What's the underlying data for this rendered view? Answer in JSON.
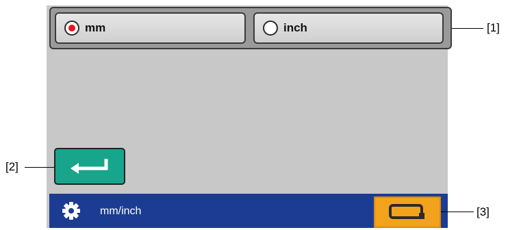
{
  "units": {
    "options": [
      {
        "label": "mm",
        "selected": true
      },
      {
        "label": "inch",
        "selected": false
      }
    ]
  },
  "status": {
    "title": "mm/inch",
    "icon": "gear-icon",
    "action_icon": "tape-cartridge-icon"
  },
  "enter_icon": "enter-arrow-icon",
  "callouts": [
    "[1]",
    "[2]",
    "[3]"
  ],
  "colors": {
    "status_bar": "#1b3c92",
    "enter_button": "#17a58c",
    "action_button": "#f3a21c",
    "selected_radio": "#e8141c"
  }
}
